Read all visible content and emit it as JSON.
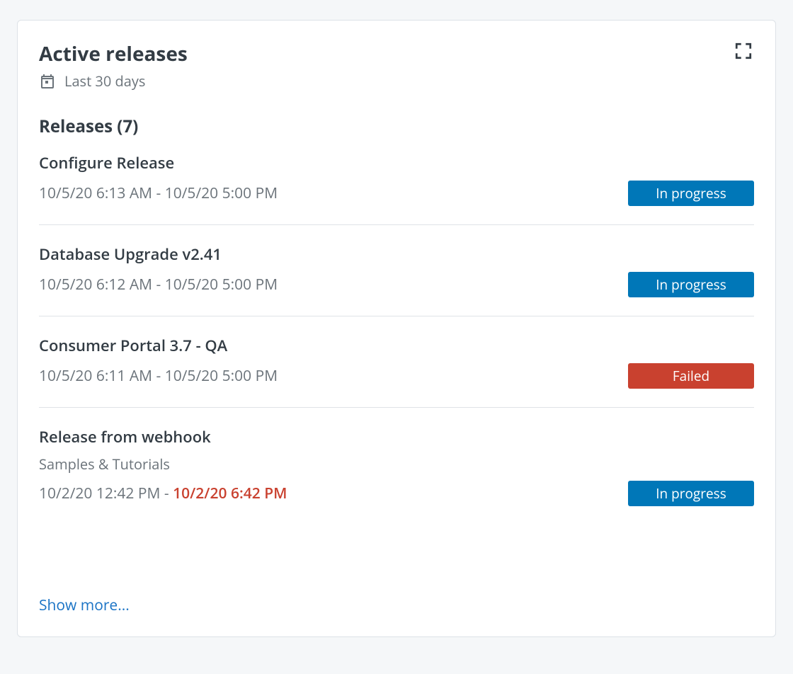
{
  "header": {
    "title": "Active releases",
    "subtitle": "Last 30 days"
  },
  "section": {
    "releases_label": "Releases",
    "releases_count": 7
  },
  "status_labels": {
    "in_progress": "In progress",
    "failed": "Failed"
  },
  "releases": [
    {
      "name": "Configure Release",
      "time_prefix": "10/5/20 6:13 AM - 10/5/20 5:00 PM",
      "time_overdue": "",
      "status": "in_progress"
    },
    {
      "name": "Database Upgrade v2.41",
      "time_prefix": "10/5/20 6:12 AM - 10/5/20 5:00 PM",
      "time_overdue": "",
      "status": "in_progress"
    },
    {
      "name": "Consumer Portal 3.7 - QA",
      "time_prefix": "10/5/20 6:11 AM - 10/5/20 5:00 PM",
      "time_overdue": "",
      "status": "failed"
    },
    {
      "name": "Release from webhook",
      "subtitle": "Samples & Tutorials",
      "time_prefix": "10/2/20 12:42 PM - ",
      "time_overdue": "10/2/20 6:42 PM",
      "status": "in_progress"
    }
  ],
  "show_more": "Show more..."
}
